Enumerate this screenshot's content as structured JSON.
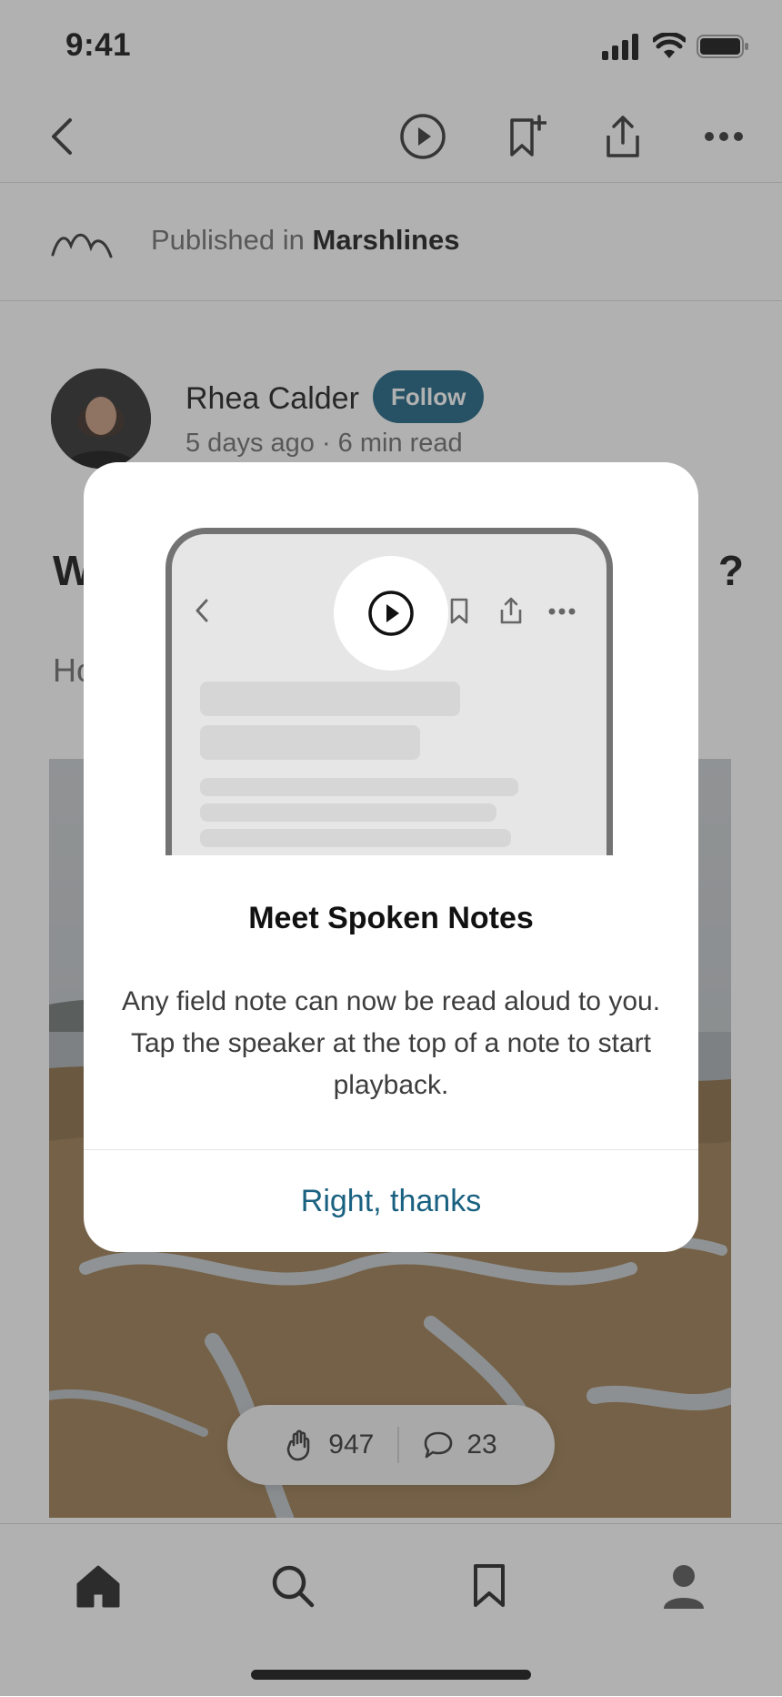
{
  "status_bar": {
    "time": "9:41"
  },
  "publication": {
    "prefix": "Published in",
    "name": "Marshlines"
  },
  "author": {
    "name": "Rhea Calder",
    "follow_label": "Follow",
    "meta": "5 days ago · 6 min read"
  },
  "article": {
    "headline_start": "W",
    "headline_end": "?",
    "subtitle_start": "Ho"
  },
  "reactions": {
    "claps": "947",
    "comments": "23"
  },
  "modal": {
    "title": "Meet Spoken Notes",
    "body": "Any field note can now be read aloud to you. Tap the speaker at the top of a note to start playback.",
    "button": "Right, thanks"
  },
  "colors": {
    "accent": "#1a6181",
    "scrim": "rgba(60,60,60,0.40)"
  },
  "icons": [
    "back-icon",
    "play-icon",
    "bookmark-add-icon",
    "share-icon",
    "more-icon",
    "publication-logo-icon",
    "clap-icon",
    "comment-icon",
    "home-icon",
    "search-icon",
    "bookmark-icon",
    "profile-icon"
  ]
}
